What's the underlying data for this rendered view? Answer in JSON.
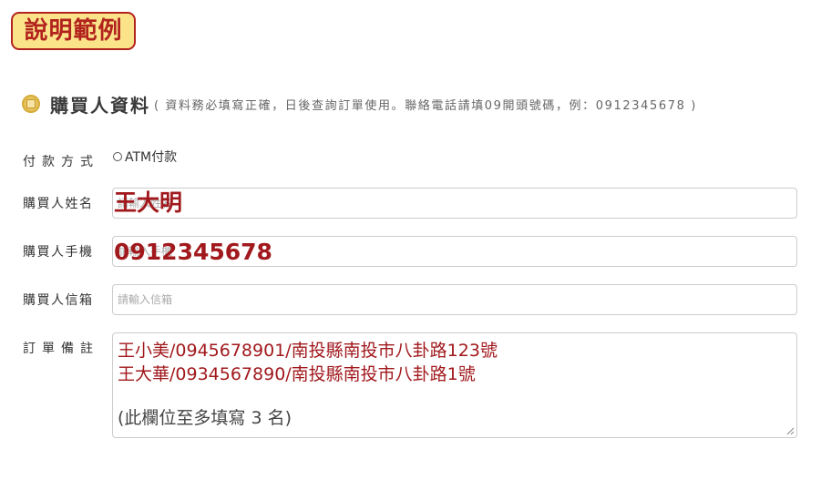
{
  "badge": {
    "label": "說明範例"
  },
  "section": {
    "icon": "coin-icon",
    "title": "購買人資料",
    "note": "( 資料務必填寫正確，日後查詢訂單使用。聯絡電話請填09開頭號碼，例：0912345678 )"
  },
  "payment": {
    "label": "付款方式",
    "option": "ATM付款",
    "selected": false
  },
  "name": {
    "label": "購買人姓名",
    "placeholder": "請輸入姓名",
    "example": "王大明"
  },
  "phone": {
    "label": "購買人手機",
    "placeholder": "請輸入手機",
    "example": "0912345678"
  },
  "email": {
    "label": "購買人信箱",
    "placeholder": "請輸入信箱"
  },
  "remarks": {
    "label": "訂單備註",
    "lines": [
      "王小美/0945678901/南投縣南投市八卦路123號",
      "王大華/0934567890/南投縣南投市八卦路1號"
    ],
    "hint": "(此欄位至多填寫 3 名)"
  },
  "colors": {
    "badge_bg": "#fbe38a",
    "accent_red": "#a1191d",
    "border": "#cccccc"
  }
}
